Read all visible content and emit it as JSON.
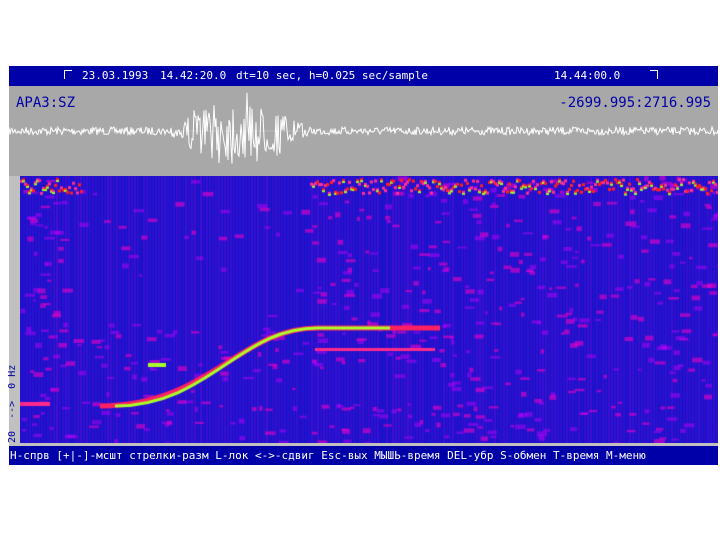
{
  "header": {
    "date": "23.03.1993",
    "start_time": "14.42:20.0",
    "params": "dt=10 sec, h=0.025 sec/sample",
    "end_time": "14.44:00.0"
  },
  "waveform": {
    "station": "APA3:SZ",
    "range": "-2699.995:2716.995"
  },
  "spectrogram": {
    "freq_axis_label": "20  -->  0 Hz"
  },
  "statusbar": {
    "help": "H-спрв [+|-]-мсшт стрелки-разм L-лок <->-сдвиг Esc-вых МЫШЬ-время DEL-убр S-обмен T-время M-меню"
  },
  "colors": {
    "title_bar": "#0000a8",
    "panel": "#c0c0c0",
    "wave_panel": "#a8a8a8",
    "spectrogram_bg": "#1010c8",
    "spectrogram_peak": "#a8ff2a"
  }
}
